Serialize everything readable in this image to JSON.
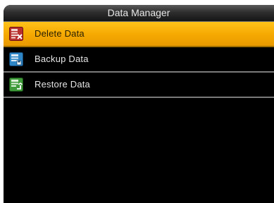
{
  "header": {
    "title": "Data Manager"
  },
  "menu": {
    "items": [
      {
        "label": "Delete Data",
        "icon": "delete-data-icon",
        "selected": true
      },
      {
        "label": "Backup Data",
        "icon": "backup-data-icon",
        "selected": false
      },
      {
        "label": "Restore Data",
        "icon": "restore-data-icon",
        "selected": false
      }
    ]
  },
  "colors": {
    "selection": "#f5a800",
    "background": "#000000",
    "divider": "#7a7a7a",
    "text": "#e6e6e6"
  }
}
